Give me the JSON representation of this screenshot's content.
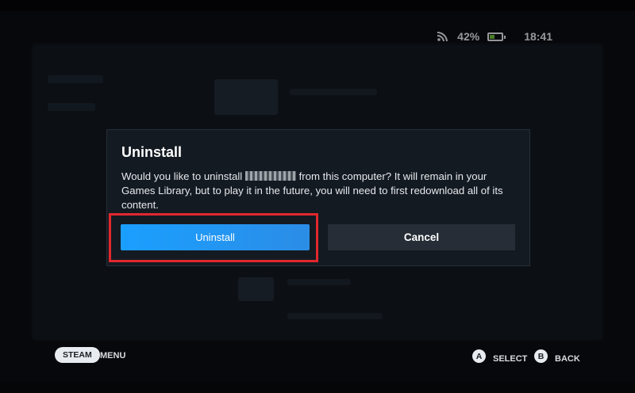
{
  "status_bar": {
    "wifi_icon": "wifi-icon",
    "battery_percent": "42%",
    "battery_level": 0.42,
    "battery_icon": "battery-icon",
    "time": "18:41"
  },
  "dialog": {
    "title": "Uninstall",
    "body_before": "Would you like to uninstall ",
    "body_after": " from this computer? It will remain in your Games Library, but to play it in the future, you will need to first redownload all of its content.",
    "uninstall_label": "Uninstall",
    "cancel_label": "Cancel"
  },
  "footer": {
    "steam_label": "STEAM",
    "menu_label": "MENU",
    "a_glyph": "A",
    "select_label": "SELECT",
    "b_glyph": "B",
    "back_label": "BACK"
  },
  "colors": {
    "accent": "#1a9fff",
    "highlight": "#e0282e"
  }
}
